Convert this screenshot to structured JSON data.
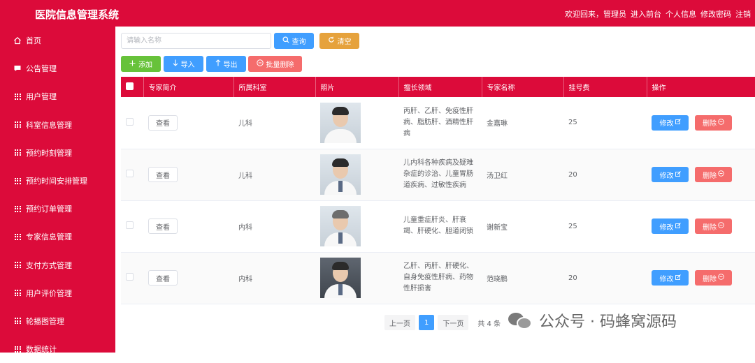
{
  "app": {
    "title": "医院信息管理系统",
    "user_links": [
      "欢迎回来，管理员",
      "进入前台",
      "个人信息",
      "修改密码",
      "注销"
    ]
  },
  "sidebar": {
    "items": [
      {
        "label": "首页",
        "icon": "home-icon"
      },
      {
        "label": "公告管理",
        "icon": "message-icon"
      },
      {
        "label": "用户管理",
        "icon": "grid-icon"
      },
      {
        "label": "科室信息管理",
        "icon": "grid-icon"
      },
      {
        "label": "预约时刻管理",
        "icon": "grid-icon"
      },
      {
        "label": "预约时间安排管理",
        "icon": "grid-icon"
      },
      {
        "label": "预约订单管理",
        "icon": "grid-icon"
      },
      {
        "label": "专家信息管理",
        "icon": "grid-icon"
      },
      {
        "label": "支付方式管理",
        "icon": "grid-icon"
      },
      {
        "label": "用户评价管理",
        "icon": "grid-icon"
      },
      {
        "label": "轮播图管理",
        "icon": "grid-icon"
      },
      {
        "label": "数据统计",
        "icon": "grid-icon"
      }
    ]
  },
  "search": {
    "placeholder": "请输入名称",
    "value": "",
    "query_label": "查询",
    "clear_label": "清空"
  },
  "toolbar": {
    "add_label": "添加",
    "import_label": "导入",
    "export_label": "导出",
    "batch_delete_label": "批量删除"
  },
  "table": {
    "columns": [
      "专家简介",
      "所属科室",
      "照片",
      "擅长领域",
      "专家名称",
      "挂号费",
      "操作"
    ],
    "view_label": "查看",
    "edit_label": "修改",
    "delete_label": "删除",
    "rows": [
      {
        "department": "儿科",
        "specialty": "丙肝、乙肝、免疫性肝病、脂肪肝、酒精性肝病",
        "name": "金嘉琳",
        "fee": "25"
      },
      {
        "department": "儿科",
        "specialty": "儿内科各种疾病及疑难杂症的诊治、儿童胃肠道疾病、过敏性疾病",
        "name": "汤卫红",
        "fee": "20"
      },
      {
        "department": "内科",
        "specialty": "儿童重症肝炎、肝衰竭、肝硬化、胆道闭锁",
        "name": "谢新宝",
        "fee": "25"
      },
      {
        "department": "内科",
        "specialty": "乙肝、丙肝、肝硬化、自身免疫性肝病、药物性肝损害",
        "name": "范晓鹏",
        "fee": "20"
      }
    ]
  },
  "pagination": {
    "prev_label": "上一页",
    "current_page": "1",
    "next_label": "下一页",
    "total_label": "共 4 条"
  },
  "watermark": {
    "text": "公众号 · 码蜂窝源码"
  },
  "colors": {
    "brand": "#dc0b3a",
    "primary": "#409eff",
    "success": "#67c23a",
    "warning": "#e6a23c",
    "danger": "#f56c6c"
  }
}
